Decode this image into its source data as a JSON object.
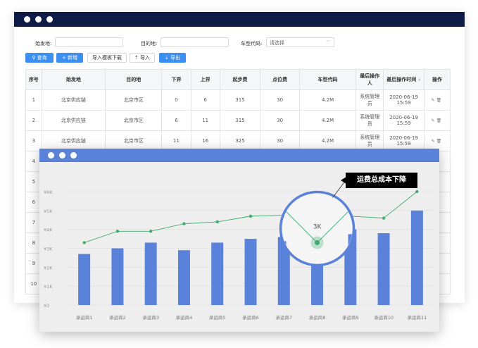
{
  "filters": {
    "origin_label": "始发地:",
    "origin_value": "",
    "dest_label": "目的地:",
    "dest_value": "",
    "vehicle_label": "车型代码:",
    "vehicle_placeholder": "请选择"
  },
  "toolbar": {
    "query": "查询",
    "add": "新增",
    "template": "导入模板下载",
    "import": "导入",
    "export": "导出"
  },
  "table": {
    "columns": [
      "序号",
      "始发地",
      "目的地",
      "下界",
      "上界",
      "起步费",
      "点位费",
      "车型代码",
      "最后操作人",
      "最后操作时间",
      "操作"
    ],
    "rows": [
      [
        "1",
        "北京供应链",
        "北京市区",
        "0",
        "6",
        "315",
        "30",
        "4.2M",
        "系统管理员",
        "2020-06-19 15:59"
      ],
      [
        "2",
        "北京供应链",
        "北京市区",
        "6",
        "11",
        "315",
        "30",
        "4.2M",
        "系统管理员",
        "2020-06-19 15:59"
      ],
      [
        "3",
        "北京供应链",
        "北京市区",
        "11",
        "16",
        "325",
        "30",
        "4.2M",
        "系统管理员",
        "2020-06-19 15:59"
      ],
      [
        "4",
        "",
        "",
        "",
        "",
        "",
        "",
        "",
        "",
        ""
      ],
      [
        "5",
        "",
        "",
        "",
        "",
        "",
        "",
        "",
        "",
        ""
      ],
      [
        "6",
        "",
        "",
        "",
        "",
        "",
        "",
        "",
        "",
        ""
      ],
      [
        "7",
        "",
        "",
        "",
        "",
        "",
        "",
        "",
        "",
        ""
      ],
      [
        "8",
        "",
        "",
        "",
        "",
        "",
        "",
        "",
        "",
        ""
      ],
      [
        "9",
        "",
        "",
        "",
        "",
        "",
        "",
        "",
        "",
        ""
      ],
      [
        "10",
        "",
        "",
        "",
        "",
        "",
        "",
        "",
        "",
        ""
      ]
    ]
  },
  "callout": "运费总成本下降",
  "chart_data": {
    "type": "bar",
    "categories": [
      "承运商1",
      "承运商2",
      "承运商3",
      "承运商4",
      "承运商5",
      "承运商6",
      "承运商7",
      "承运商8",
      "承运商9",
      "承运商10",
      "承运商11"
    ],
    "series": [
      {
        "values": [
          2700,
          3000,
          3300,
          2900,
          3300,
          3500,
          3600,
          2400,
          4000,
          3800,
          5000
        ]
      },
      {
        "values": [
          3300,
          3900,
          3900,
          4300,
          4400,
          4700,
          4750,
          3300,
          4700,
          4600,
          6000
        ]
      }
    ],
    "highlight": {
      "index": 7,
      "label": "3K"
    },
    "ylim": [
      0,
      6000
    ],
    "yticks": [
      "¥0",
      "¥1K",
      "¥2K",
      "¥3K",
      "¥4K",
      "¥5K",
      "¥6K"
    ],
    "bar_color": "#5a82db",
    "line_color": "#3daa6e",
    "grid": true
  }
}
